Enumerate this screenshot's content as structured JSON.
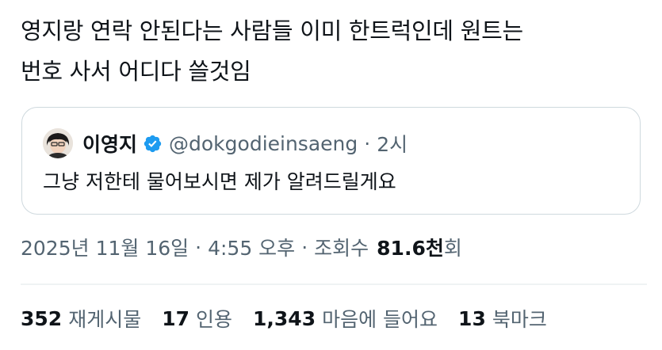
{
  "post": {
    "text": "영지랑 연락 안된다는 사람들 이미 한트럭인데 원트는\n번호 사서 어디다 쓸것임"
  },
  "quote": {
    "name": "이영지",
    "handle": "@dokgodieinsaeng",
    "dot": "·",
    "time": "2시",
    "text": "그냥 저한테 물어보시면 제가 알려드릴게요",
    "avatar_icon": "profile-avatar",
    "verified_icon": "verified-badge-icon",
    "verified_color": "#1d9bf0"
  },
  "meta": {
    "date": "2025년 11월 16일",
    "sep1": "·",
    "time": "4:55 오후",
    "sep2": "·",
    "views_label": "조회수",
    "views_count": "81.6천",
    "views_suffix": "회"
  },
  "stats": [
    {
      "num": "352",
      "label": "재게시물"
    },
    {
      "num": "17",
      "label": "인용"
    },
    {
      "num": "1,343",
      "label": "마음에 들어요"
    },
    {
      "num": "13",
      "label": "북마크"
    }
  ],
  "colors": {
    "text": "#0f1419",
    "secondary": "#536471",
    "border": "#cfd9de",
    "divider": "#eff3f4"
  }
}
